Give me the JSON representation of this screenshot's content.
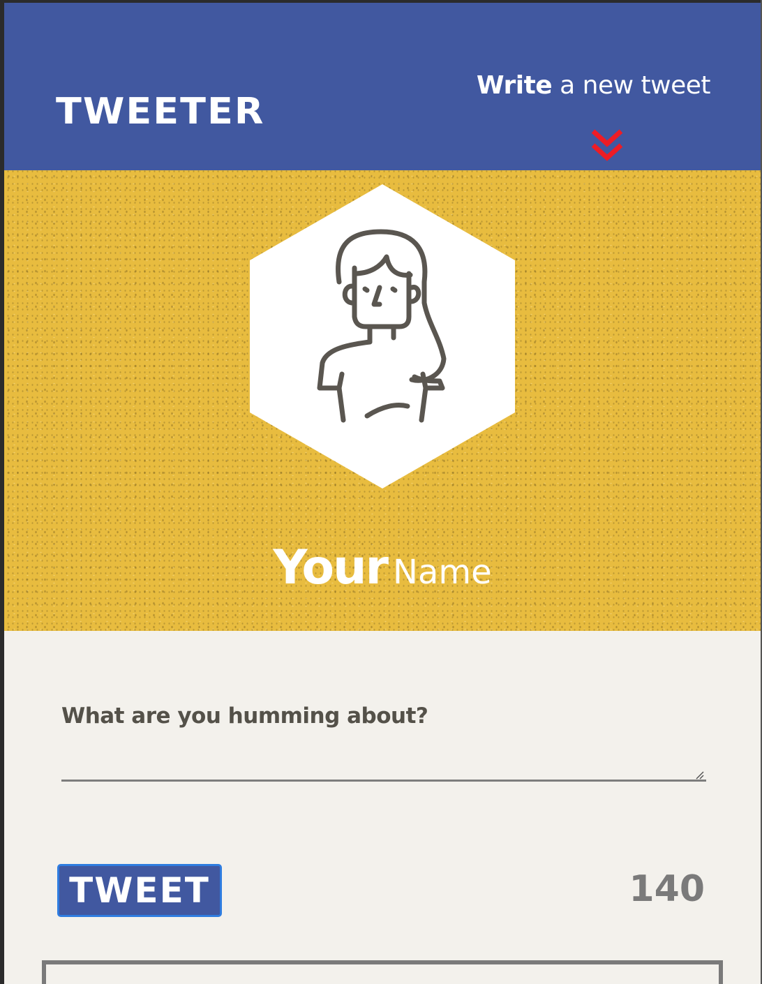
{
  "nav": {
    "logo": "TWEETER",
    "compose_bold": "Write",
    "compose_rest": "a new tweet",
    "compose_icon": "double-chevron-down-icon",
    "nav_color": "#4158a0",
    "accent_color": "#ee1c25"
  },
  "profile": {
    "avatar_icon": "woman-avatar-icon",
    "first_name": "Your",
    "last_name": "Name",
    "background_color": "#e8bc3f"
  },
  "composer": {
    "placeholder": "What are you humming about?",
    "button_label": "TWEET",
    "counter": "140"
  }
}
